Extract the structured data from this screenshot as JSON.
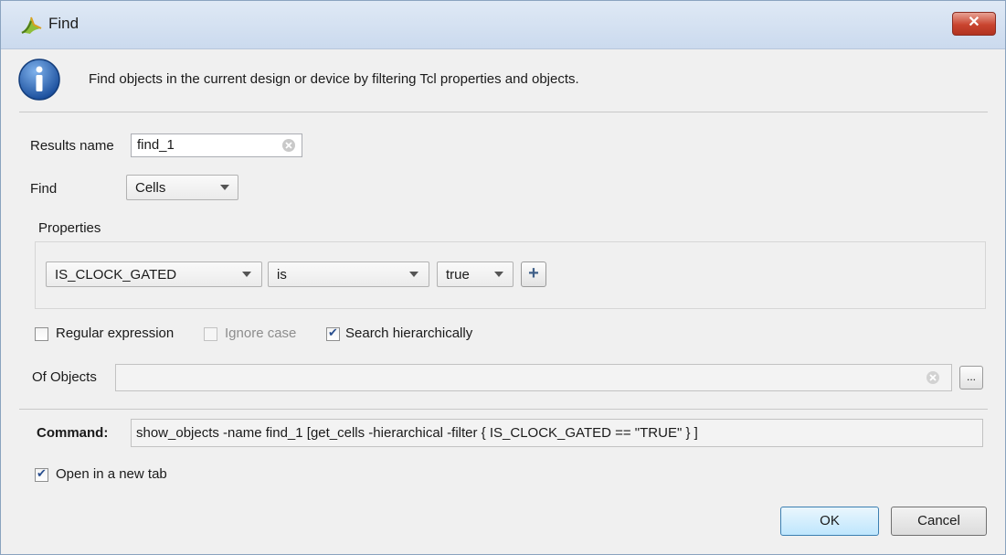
{
  "window": {
    "title": "Find",
    "close_label": "✕"
  },
  "info": {
    "text": "Find objects in the current design or device by filtering Tcl properties and objects."
  },
  "form": {
    "results_name_label": "Results name",
    "results_name_value": "find_1",
    "find_label": "Find",
    "find_value": "Cells",
    "properties_label": "Properties",
    "property_field": "IS_CLOCK_GATED",
    "property_operator": "is",
    "property_value": "true",
    "add_label": "+",
    "regex_label": "Regular expression",
    "regex_checked": false,
    "ignore_case_label": "Ignore case",
    "ignore_case_checked": false,
    "search_hier_label": "Search hierarchically",
    "search_hier_checked": true,
    "of_objects_label": "Of Objects",
    "of_objects_value": "",
    "browse_label": "...",
    "command_label": "Command:",
    "command_value": "show_objects -name find_1 [get_cells -hierarchical -filter { IS_CLOCK_GATED == \"TRUE\" } ]",
    "new_tab_label": "Open in a new tab",
    "new_tab_checked": true
  },
  "buttons": {
    "ok": "OK",
    "cancel": "Cancel"
  }
}
